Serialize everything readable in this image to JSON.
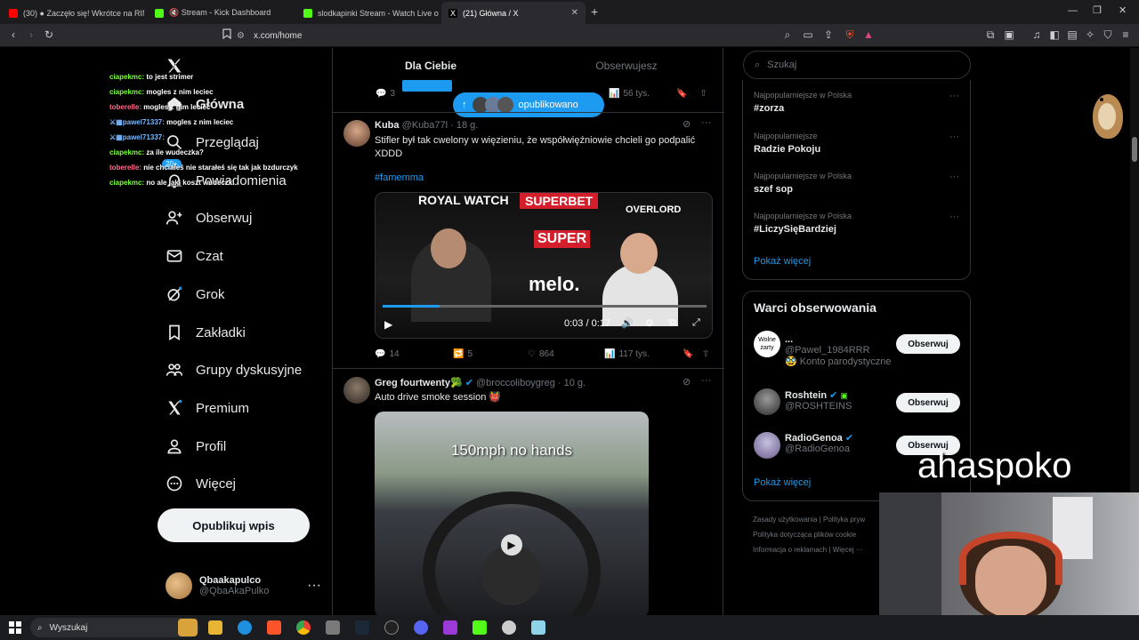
{
  "tabs": [
    {
      "label": "(30)  ● Zaczęło się! Wkrótce na RIN",
      "color": "#ff0000"
    },
    {
      "label": "🔇 Stream - Kick Dashboard",
      "color": "#53fc18"
    },
    {
      "label": "slodkapinki Stream - Watch Live on K",
      "color": "#53fc18"
    },
    {
      "label": "(21) Główna / X",
      "color": "#ffffff"
    }
  ],
  "address": "x.com/home",
  "nav": {
    "items": [
      {
        "label": "Główna",
        "icon": "home-icon"
      },
      {
        "label": "Przeglądaj",
        "icon": "search-icon"
      },
      {
        "label": "Powiadomienia",
        "icon": "bell-icon",
        "badge": "20+"
      },
      {
        "label": "Obserwuj",
        "icon": "person-plus-icon"
      },
      {
        "label": "Czat",
        "icon": "mail-icon"
      },
      {
        "label": "Grok",
        "icon": "grok-icon"
      },
      {
        "label": "Zakładki",
        "icon": "bookmark-icon"
      },
      {
        "label": "Grupy dyskusyjne",
        "icon": "communities-icon"
      },
      {
        "label": "Premium",
        "icon": "x-logo-icon"
      },
      {
        "label": "Profil",
        "icon": "person-icon"
      },
      {
        "label": "Więcej",
        "icon": "more-circle-icon"
      }
    ],
    "post_button": "Opublikuj wpis",
    "account_name": "Qbaakapulco",
    "account_handle": "@QbaAkaPulko"
  },
  "chat": [
    {
      "user": "ciapekmc:",
      "text": "to jest strimer",
      "color": "#7fff3a"
    },
    {
      "user": "ciapekmc:",
      "text": "mogles z nim leciec",
      "color": "#7fff3a"
    },
    {
      "user": "toberelle:",
      "text": "mogles z nim leciec",
      "color": "#ff6b8a"
    },
    {
      "user": "pawel71337:",
      "text": "mogles z nim leciec",
      "color": "#7ab8ff"
    },
    {
      "user": "pawel71337:",
      "text": "",
      "color": "#7ab8ff"
    },
    {
      "user": "ciapekmc:",
      "text": "za ile wudeczka?",
      "color": "#7fff3a"
    },
    {
      "user": "toberelle:",
      "text": "nie chciałeś nie starałeś się tak jak bzdurczyk",
      "color": "#ff6b8a"
    },
    {
      "user": "ciapekmc:",
      "text": "no ale jaki koszt wudeczki",
      "color": "#7fff3a"
    }
  ],
  "feed": {
    "tab_for_you": "Dla Ciebie",
    "tab_following": "Obserwujesz",
    "new_posts_pill": "opublikowano",
    "prev_actions": {
      "replies": "3",
      "views": "56 tys."
    },
    "tweets": [
      {
        "name": "Kuba",
        "handle": "@Kuba77l",
        "time": "· 18 g.",
        "text": "Stifler był tak cwelony w więzieniu, że  współwięźniowie chcieli go podpalić XDDD",
        "hashtag": "#famemma",
        "video_time": "0:03 / 0:17",
        "video_labels": [
          "ROYAL WATCH",
          "SUPERBET",
          "OVERLORD",
          "SUPER",
          "melo."
        ],
        "replies": "14",
        "reposts": "5",
        "likes": "864",
        "views": "117 tys."
      },
      {
        "name": "Greg fourtwenty🥦",
        "handle": "@broccoliboygreg",
        "time": "· 10 g.",
        "text": "Auto drive smoke session 👹",
        "overlay": "150mph no hands"
      }
    ]
  },
  "right": {
    "search_placeholder": "Szukaj",
    "trends": [
      {
        "sub": "Najpopularniejsze w Polska",
        "title": "#zorza"
      },
      {
        "sub": "Najpopularniejsze",
        "title": "Radzie Pokoju"
      },
      {
        "sub": "Najpopularniejsze w Polska",
        "title": "szef sop"
      },
      {
        "sub": "Najpopularniejsze w Polska",
        "title": "#LiczySięBardziej"
      }
    ],
    "show_more": "Pokaż więcej",
    "who_title": "Warci obserwowania",
    "who": [
      {
        "name": "...",
        "handle": "@Pawel_1984RRR",
        "extra": "🥸 Konto parodystyczne",
        "avatar_text": "Wolne żarty"
      },
      {
        "name": "Roshtein",
        "handle": "@ROSHTEINS"
      },
      {
        "name": "RadioGenoa",
        "handle": "@RadioGenoa"
      }
    ],
    "follow_label": "Obserwuj",
    "footer": [
      "Zasady użytkowania",
      "Polityka pryw",
      "Polityka dotycząca plików cookie",
      "Informacja o reklamach",
      "Więcej ···"
    ]
  },
  "overlay_text": "ahaspoko",
  "taskbar": {
    "search": "Wyszukaj"
  }
}
